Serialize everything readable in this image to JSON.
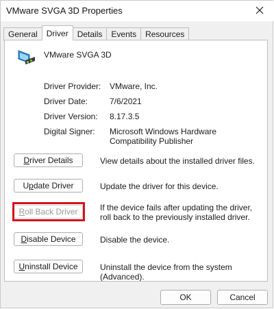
{
  "window": {
    "title": "VMware SVGA 3D Properties"
  },
  "tabs": [
    {
      "label": "General",
      "active": false
    },
    {
      "label": "Driver",
      "active": true
    },
    {
      "label": "Details",
      "active": false
    },
    {
      "label": "Events",
      "active": false
    },
    {
      "label": "Resources",
      "active": false
    }
  ],
  "device": {
    "name": "VMware SVGA 3D",
    "icon": "display-adapter-icon"
  },
  "properties": {
    "provider": {
      "label": "Driver Provider:",
      "value": "VMware, Inc."
    },
    "date": {
      "label": "Driver Date:",
      "value": "7/6/2021"
    },
    "version": {
      "label": "Driver Version:",
      "value": "8.17.3.5"
    },
    "signer": {
      "label": "Digital Signer:",
      "value": "Microsoft Windows Hardware Compatibility Publisher"
    }
  },
  "actions": {
    "details": {
      "label_pre": "",
      "label_key": "D",
      "label_post": "river Details",
      "description": "View details about the installed driver files."
    },
    "update": {
      "label_pre": "U",
      "label_key": "p",
      "label_post": "date Driver",
      "description": "Update the driver for this device."
    },
    "rollback": {
      "label_pre": "",
      "label_key": "R",
      "label_post": "oll Back Driver",
      "description": "If the device fails after updating the driver, roll back to the previously installed driver.",
      "enabled": false
    },
    "disable": {
      "label_pre": "",
      "label_key": "D",
      "label_post": "isable Device",
      "description": "Disable the device."
    },
    "uninstall": {
      "label_pre": "",
      "label_key": "U",
      "label_post": "ninstall Device",
      "description": "Uninstall the device from the system (Advanced)."
    }
  },
  "footer": {
    "ok": "OK",
    "cancel": "Cancel"
  },
  "colors": {
    "highlight": "#d0121b",
    "panel": "#ffffff",
    "chrome": "#f0f0f0"
  }
}
